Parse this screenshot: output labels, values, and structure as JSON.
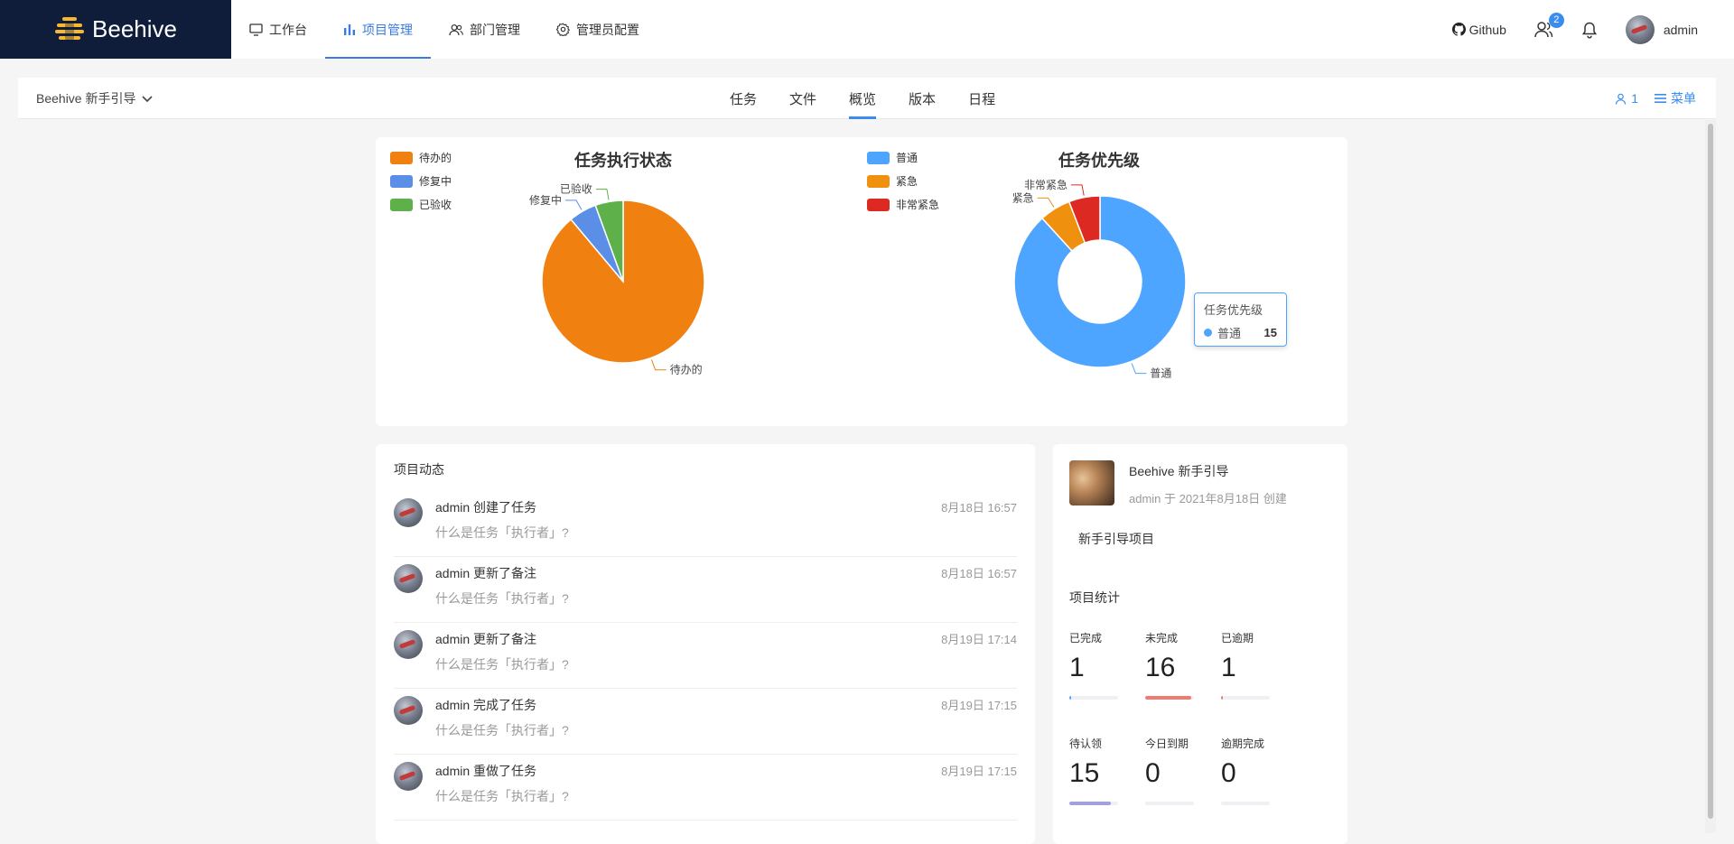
{
  "app": {
    "logo_text": "Beehive"
  },
  "nav": [
    {
      "label": "工作台",
      "icon": "monitor-icon",
      "active": false
    },
    {
      "label": "项目管理",
      "icon": "bar-chart-icon",
      "active": true
    },
    {
      "label": "部门管理",
      "icon": "team-icon",
      "active": false
    },
    {
      "label": "管理员配置",
      "icon": "gear-icon",
      "active": false
    }
  ],
  "header_right": {
    "github_label": "Github",
    "notification_count": "2",
    "username": "admin"
  },
  "subbar": {
    "project_name": "Beehive 新手引导",
    "tabs": [
      "任务",
      "文件",
      "概览",
      "版本",
      "日程"
    ],
    "active_tab": 2,
    "member_count": "1",
    "menu_label": "菜单"
  },
  "charts": {
    "status_title": "任务执行状态",
    "priority_title": "任务优先级",
    "tooltip": {
      "title": "任务优先级",
      "label": "普通",
      "value": "15"
    }
  },
  "chart_data": [
    {
      "type": "pie",
      "title": "任务执行状态",
      "categories": [
        "待办的",
        "修复中",
        "已验收"
      ],
      "values": [
        16,
        1,
        1
      ],
      "colors": [
        "#f0800f",
        "#5b8ee6",
        "#5eb14a"
      ],
      "legend": "top-left"
    },
    {
      "type": "pie",
      "title": "任务优先级",
      "categories": [
        "普通",
        "紧急",
        "非常紧急"
      ],
      "values": [
        15,
        1,
        1
      ],
      "colors": [
        "#4ea5ff",
        "#f0900f",
        "#dc2a22"
      ],
      "legend": "top-left",
      "donut": true
    }
  ],
  "activity": {
    "title": "项目动态",
    "items": [
      {
        "action": "admin 创建了任务",
        "time": "8月18日 16:57",
        "detail": "什么是任务「执行者」?"
      },
      {
        "action": "admin 更新了备注",
        "time": "8月18日 16:57",
        "detail": "什么是任务「执行者」?"
      },
      {
        "action": "admin 更新了备注",
        "time": "8月19日 17:14",
        "detail": "什么是任务「执行者」?"
      },
      {
        "action": "admin 完成了任务",
        "time": "8月19日 17:15",
        "detail": "什么是任务「执行者」?"
      },
      {
        "action": "admin 重做了任务",
        "time": "8月19日 17:15",
        "detail": "什么是任务「执行者」?"
      }
    ]
  },
  "project_info": {
    "name": "Beehive 新手引导",
    "meta": "admin 于 2021年8月18日 创建",
    "description": "新手引导项目",
    "stats_title": "项目统计",
    "stats": [
      {
        "label": "已完成",
        "value": "1",
        "fill": 0.04,
        "color": "#4ea5ff"
      },
      {
        "label": "未完成",
        "value": "16",
        "fill": 0.95,
        "color": "#f07a72"
      },
      {
        "label": "已逾期",
        "value": "1",
        "fill": 0.04,
        "color": "#f07a72"
      },
      {
        "label": "待认领",
        "value": "15",
        "fill": 0.85,
        "color": "#a3a0df"
      },
      {
        "label": "今日到期",
        "value": "0",
        "fill": 0,
        "color": "#a3a0df"
      },
      {
        "label": "逾期完成",
        "value": "0",
        "fill": 0,
        "color": "#a3a0df"
      }
    ]
  }
}
